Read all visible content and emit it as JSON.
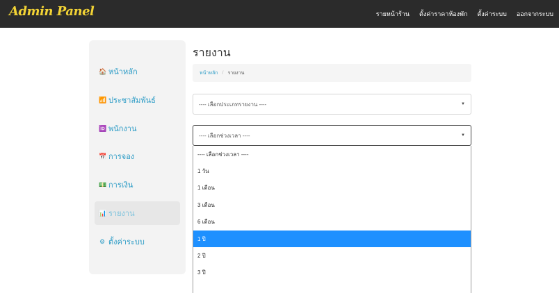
{
  "navbar": {
    "brand": "Admin Panel",
    "links": [
      "รายหน้าร้าน",
      "ตั้งค่าราคาห้องพัก",
      "ตั้งค่าระบบ",
      "ออกจากระบบ"
    ]
  },
  "sidebar": {
    "items": [
      {
        "icon": "home-icon",
        "glyph": "🏠",
        "label": "หน้าหลัก"
      },
      {
        "icon": "rss-icon",
        "glyph": "📶",
        "label": "ประชาสัมพันธ์"
      },
      {
        "icon": "id-card-icon",
        "glyph": "🆔",
        "label": "พนักงาน"
      },
      {
        "icon": "calendar-icon",
        "glyph": "📅",
        "label": "การจอง"
      },
      {
        "icon": "money-icon",
        "glyph": "💵",
        "label": "การเงิน"
      },
      {
        "icon": "chart-icon",
        "glyph": "📊",
        "label": "รายงาน",
        "active": true
      },
      {
        "icon": "gear-icon",
        "glyph": "⚙",
        "label": "ตั้งค่าระบบ"
      }
    ]
  },
  "page": {
    "title": "รายงาน",
    "breadcrumb": {
      "home": "หน้าหลัก",
      "separator": "/",
      "current": "รายงาน"
    }
  },
  "filters": {
    "report_type": {
      "value": "---- เลือกประเภทรายงาน ----"
    },
    "period": {
      "value": "---- เลือกช่วงเวลา ----",
      "options": [
        "---- เลือกช่วงเวลา ----",
        "1 วัน",
        "1 เดือน",
        "3 เดือน",
        "6 เดือน",
        "1 ปี",
        "2 ปี",
        "3 ปี"
      ],
      "highlighted_index": 5
    }
  },
  "colors": {
    "navbar_bg": "#2b2b2b",
    "brand": "#f2d335",
    "sidebar_link": "#2d9cc6",
    "highlight": "#1e90ff"
  }
}
